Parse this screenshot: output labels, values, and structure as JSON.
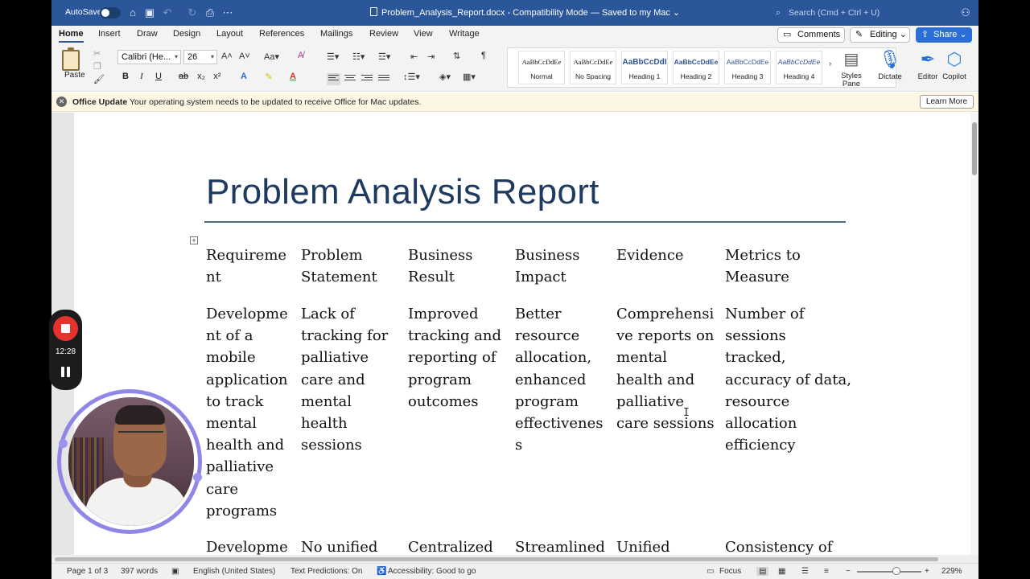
{
  "titlebar": {
    "autosave_label": "AutoSave",
    "document_name": "Problem_Analysis_Report.docx",
    "status": " -  Compatibility Mode — Saved to my Mac ⌄",
    "search_placeholder": "Search (Cmd + Ctrl + U)"
  },
  "tabs": [
    "Home",
    "Insert",
    "Draw",
    "Design",
    "Layout",
    "References",
    "Mailings",
    "Review",
    "View",
    "Writage"
  ],
  "actions": {
    "comments": "Comments",
    "editing": "Editing",
    "share": "Share"
  },
  "ribbon": {
    "paste": "Paste",
    "font_name": "Calibri (He...",
    "font_size": "26",
    "styles": [
      {
        "sample": "AaBbCcDdEe",
        "name": "Normal"
      },
      {
        "sample": "AaBbCcDdEe",
        "name": "No Spacing"
      },
      {
        "sample": "AaBbCcDdI",
        "name": "Heading 1"
      },
      {
        "sample": "AaBbCcDdEe",
        "name": "Heading 2"
      },
      {
        "sample": "AaBbCcDdEe",
        "name": "Heading 3"
      },
      {
        "sample": "AaBbCcDdEe",
        "name": "Heading 4"
      }
    ],
    "styles_pane": "Styles\nPane",
    "dictate": "Dictate",
    "editor": "Editor",
    "copilot": "Copilot"
  },
  "message_bar": {
    "label": "Office Update",
    "text": "Your operating system needs to be updated to receive Office for Mac updates.",
    "button": "Learn More"
  },
  "document": {
    "title": "Problem Analysis Report",
    "headers": [
      "Requireme\nnt",
      "Problem\nStatement",
      "Business\nResult",
      "Business\nImpact",
      "Evidence",
      "Metrics to\nMeasure"
    ],
    "rows": [
      [
        "Developme\nnt of a\nmobile\napplication\nto track\nmental\nhealth and\npalliative\ncare\nprograms",
        "Lack of\ntracking for\npalliative\ncare and\nmental\nhealth\nsessions",
        "Improved\ntracking and\nreporting of\nprogram\noutcomes",
        "Better\nresource\nallocation,\nenhanced\nprogram\neffectivenes\ns",
        "Comprehensi\nve reports on\nmental\nhealth and\npalliative\ncare sessions",
        "Number of\nsessions\ntracked,\naccuracy of data,\nresource\nallocation\nefficiency"
      ],
      [
        "Developme",
        "No unified",
        "Centralized",
        "Streamlined",
        "Unified",
        "Consistency of"
      ]
    ]
  },
  "statusbar": {
    "page": "Page 1 of 3",
    "words": "397 words",
    "language": "English (United States)",
    "predictions": "Text Predictions: On",
    "accessibility": "Accessibility: Good to go",
    "focus": "Focus",
    "zoom": "229%"
  },
  "recorder": {
    "time": "12:28"
  },
  "colors": {
    "titlebar": "#2b579a",
    "accent": "#2b6fd6",
    "title_text": "#1f3a5f",
    "record": "#e5322d",
    "cam_ring": "#8f86e6"
  }
}
